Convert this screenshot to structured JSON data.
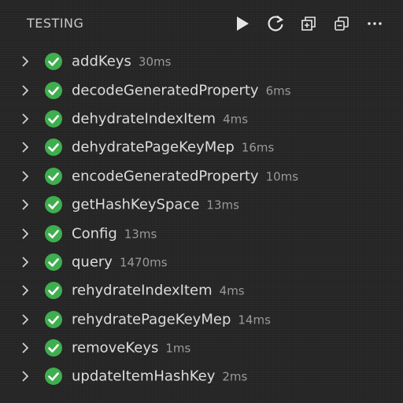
{
  "header": {
    "title": "TESTING",
    "actions": [
      {
        "icon": "run-icon"
      },
      {
        "icon": "refresh-icon"
      },
      {
        "icon": "new-file-icon"
      },
      {
        "icon": "collapse-all-icon"
      },
      {
        "icon": "more-icon"
      }
    ]
  },
  "colors": {
    "pass": "#3fae4f",
    "background": "#262626"
  },
  "tests": [
    {
      "name": "addKeys",
      "time": "30ms",
      "status": "passed"
    },
    {
      "name": "decodeGeneratedProperty",
      "time": "6ms",
      "status": "passed"
    },
    {
      "name": "dehydrateIndexItem",
      "time": "4ms",
      "status": "passed"
    },
    {
      "name": "dehydratePageKeyMep",
      "time": "16ms",
      "status": "passed"
    },
    {
      "name": "encodeGeneratedProperty",
      "time": "10ms",
      "status": "passed"
    },
    {
      "name": "getHashKeySpace",
      "time": "13ms",
      "status": "passed"
    },
    {
      "name": "Config",
      "time": "13ms",
      "status": "passed"
    },
    {
      "name": "query",
      "time": "1470ms",
      "status": "passed"
    },
    {
      "name": "rehydrateIndexItem",
      "time": "4ms",
      "status": "passed"
    },
    {
      "name": "rehydratePageKeyMep",
      "time": "14ms",
      "status": "passed"
    },
    {
      "name": "removeKeys",
      "time": "1ms",
      "status": "passed"
    },
    {
      "name": "updateItemHashKey",
      "time": "2ms",
      "status": "passed"
    }
  ]
}
